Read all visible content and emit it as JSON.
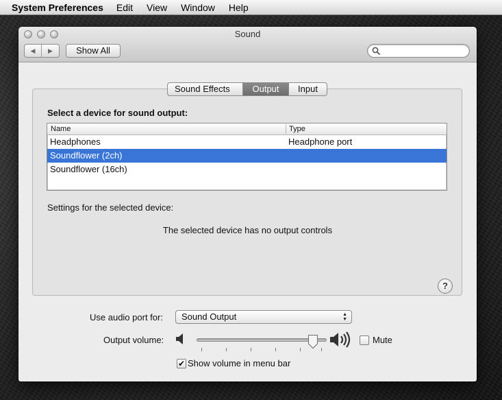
{
  "menubar": {
    "app_name": "System Preferences",
    "items": [
      "Edit",
      "View",
      "Window",
      "Help"
    ]
  },
  "window": {
    "title": "Sound",
    "show_all_label": "Show All",
    "search": {
      "value": "",
      "placeholder": ""
    }
  },
  "tabs": [
    {
      "label": "Sound Effects",
      "selected": false
    },
    {
      "label": "Output",
      "selected": true
    },
    {
      "label": "Input",
      "selected": false
    }
  ],
  "output": {
    "heading": "Select a device for sound output:",
    "columns": {
      "name": "Name",
      "type": "Type"
    },
    "devices": [
      {
        "name": "Headphones",
        "type": "Headphone port",
        "selected": false
      },
      {
        "name": "Soundflower (2ch)",
        "type": "",
        "selected": true
      },
      {
        "name": "Soundflower (16ch)",
        "type": "",
        "selected": false
      }
    ],
    "settings_label": "Settings for the selected device:",
    "no_controls_message": "The selected device has no output controls",
    "help_label": "?"
  },
  "bottom": {
    "port_label": "Use audio port for:",
    "port_value": "Sound Output",
    "volume_label": "Output volume:",
    "volume_level": 0.93,
    "mute_label": "Mute",
    "mute_checked": false,
    "show_in_menubar_label": "Show volume in menu bar",
    "show_in_menubar_checked": true
  },
  "colors": {
    "selection": "#3875d7",
    "window_bg": "#ececec"
  }
}
